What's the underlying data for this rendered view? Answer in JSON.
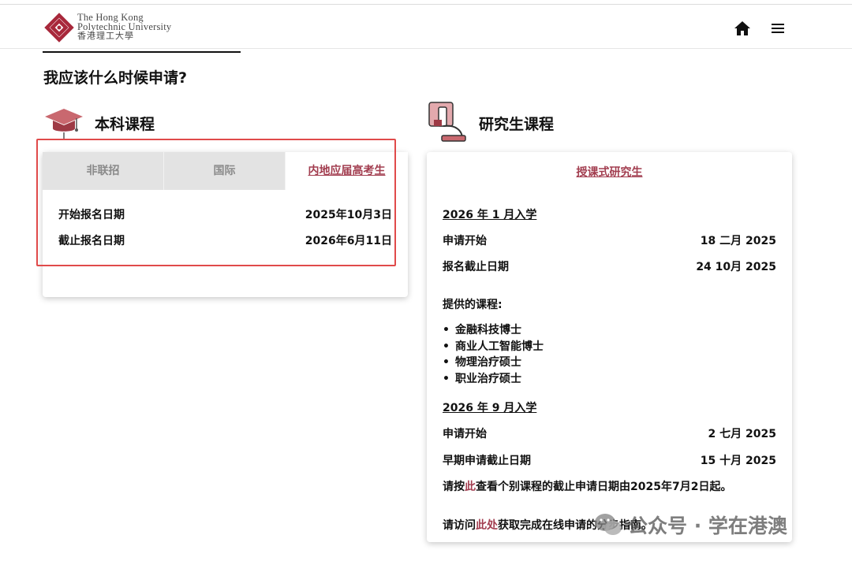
{
  "header": {
    "logo_line1": "The Hong Kong",
    "logo_line2": "Polytechnic University",
    "logo_line3": "香港理工大學"
  },
  "page_title": "我应该什么时候申请?",
  "undergraduate": {
    "title": "本科课程",
    "tabs": [
      "非联招",
      "国际",
      "内地应届高考生"
    ],
    "rows": [
      {
        "label": "开始报名日期",
        "value": "2025年10月3日"
      },
      {
        "label": "截止报名日期",
        "value": "2026年6月11日"
      }
    ]
  },
  "postgraduate": {
    "title": "研究生课程",
    "tab": "授课式研究生",
    "intake1": {
      "heading": "2026 年 1 月入学",
      "rows": [
        {
          "label": "申请开始",
          "value": "18 二月 2025"
        },
        {
          "label": "报名截止日期",
          "value": "24 10月 2025"
        }
      ],
      "programs_heading": "提供的课程:",
      "programs": [
        "金融科技博士",
        "商业人工智能博士",
        "物理治疗硕士",
        "职业治疗硕士"
      ]
    },
    "intake2": {
      "heading": "2026 年 9 月入学",
      "rows": [
        {
          "label": "申请开始",
          "value": "2 七月 2025"
        },
        {
          "label": "早期申请截止日期",
          "value": "15 十月 2025"
        }
      ],
      "note_prefix": "请按",
      "note_link": "此",
      "note_suffix": "查看个别课程的截止申请日期由2025年7月2日起。",
      "guide_prefix": "请访问",
      "guide_link": "此处",
      "guide_suffix": "获取完成在线申请的分步指南。"
    }
  },
  "watermark": {
    "text": "公众号 · 学在港澳"
  },
  "colors": {
    "accent": "#a23d4f",
    "highlight": "#e04a4a",
    "tab_inactive": "#e3e3e3"
  }
}
